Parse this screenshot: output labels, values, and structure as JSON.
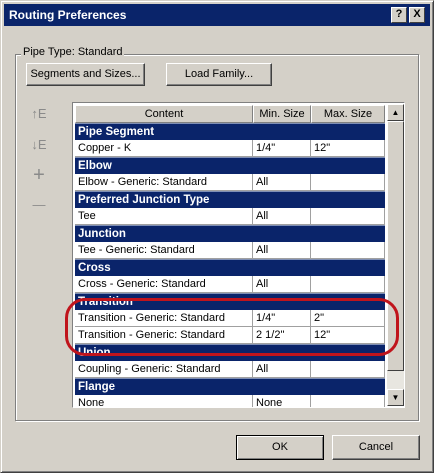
{
  "window": {
    "title": "Routing Preferences",
    "help_button": "?",
    "close_button": "X"
  },
  "pipe_type_label": "Pipe Type: Standard",
  "buttons": {
    "segments_and_sizes": "Segments and Sizes...",
    "load_family": "Load Family...",
    "ok": "OK",
    "cancel": "Cancel"
  },
  "side_tools": [
    {
      "icon": "move-up-icon",
      "glyph": "↑E"
    },
    {
      "icon": "move-down-icon",
      "glyph": "↓E"
    },
    {
      "icon": "add-row-icon",
      "glyph": "+"
    },
    {
      "icon": "remove-row-icon",
      "glyph": "—"
    }
  ],
  "table": {
    "headers": [
      "Content",
      "Min. Size",
      "Max. Size"
    ],
    "groups": [
      {
        "name": "Pipe Segment",
        "rows": [
          [
            "Copper - K",
            "1/4\"",
            "12\""
          ]
        ]
      },
      {
        "name": "Elbow",
        "rows": [
          [
            "Elbow - Generic: Standard",
            "All",
            ""
          ]
        ]
      },
      {
        "name": "Preferred Junction Type",
        "rows": [
          [
            "Tee",
            "All",
            ""
          ]
        ]
      },
      {
        "name": "Junction",
        "rows": [
          [
            "Tee - Generic: Standard",
            "All",
            ""
          ]
        ]
      },
      {
        "name": "Cross",
        "rows": [
          [
            "Cross - Generic: Standard",
            "All",
            ""
          ]
        ]
      },
      {
        "name": "Transition",
        "rows": [
          [
            "Transition - Generic: Standard",
            "1/4\"",
            "2\""
          ],
          [
            "Transition - Generic: Standard",
            "2 1/2\"",
            "12\""
          ]
        ]
      },
      {
        "name": "Union",
        "rows": [
          [
            "Coupling - Generic: Standard",
            "All",
            ""
          ]
        ]
      },
      {
        "name": "Flange",
        "rows": [
          [
            "None",
            "None",
            ""
          ]
        ]
      }
    ]
  },
  "colors": {
    "title_bar": "#0a246a",
    "group_header": "#0a246a",
    "highlight_ellipse": "#c0141c",
    "dialog_face": "#d4d0c8"
  }
}
